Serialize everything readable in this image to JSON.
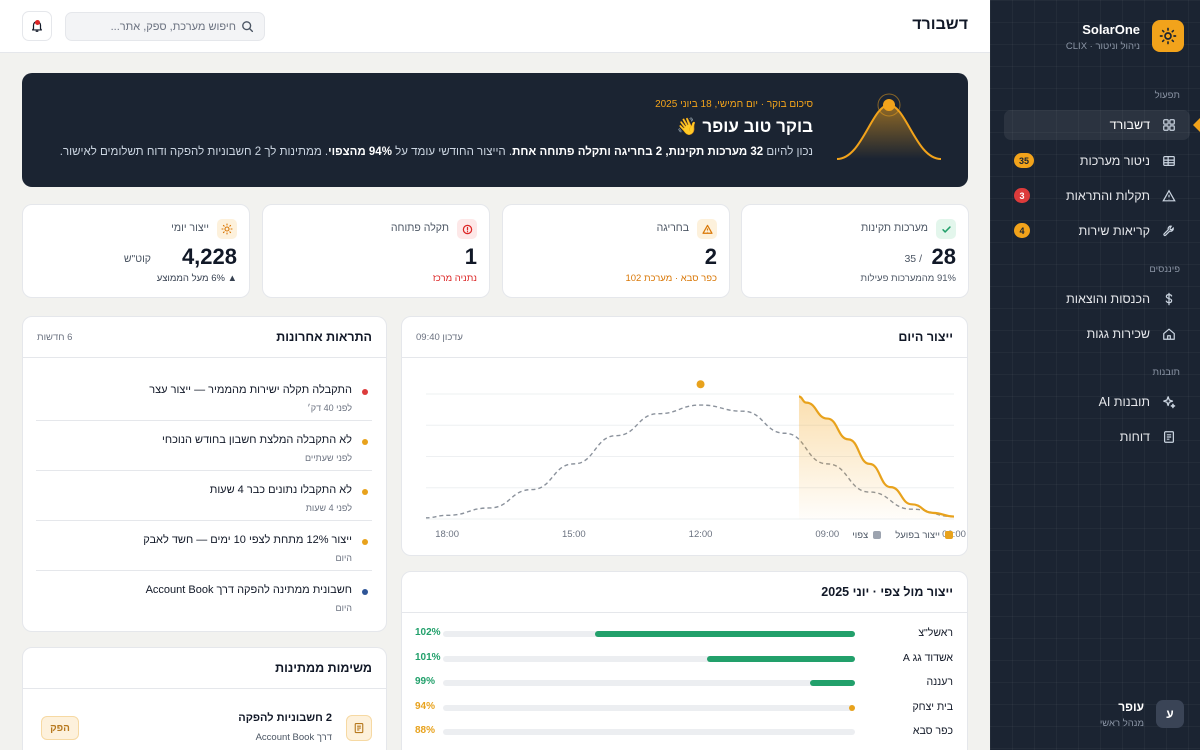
{
  "brand": {
    "name": "SolarOne",
    "subtitle": "ניהול וניטור · CLIX"
  },
  "sidebar": {
    "sections": {
      "operations": "תפעול",
      "finance": "פיננסים",
      "features": "תובנות"
    },
    "items": [
      {
        "label": "דשבורד",
        "icon": "grid-icon",
        "active": true
      },
      {
        "label": "ניטור מערכות",
        "icon": "table-icon",
        "badge": "35",
        "badge_color": "#f2a31b"
      },
      {
        "label": "תקלות והתראות",
        "icon": "warning-icon",
        "badge": "3",
        "badge_color": "#dc3b3b"
      },
      {
        "label": "קריאות שירות",
        "icon": "wrench-icon",
        "badge": "4",
        "badge_color": "#f2a31b"
      },
      {
        "label": "הכנסות והוצאות",
        "icon": "dollar-icon"
      },
      {
        "label": "שכירות גגות",
        "icon": "home-icon"
      },
      {
        "label": "תובנות AI",
        "icon": "sparkle-icon"
      },
      {
        "label": "דוחות",
        "icon": "document-icon"
      }
    ]
  },
  "user": {
    "initial": "ע",
    "name": "עופר",
    "role": "מנהל ראשי"
  },
  "topbar": {
    "title": "דשבורד",
    "search_placeholder": "חיפוש מערכת, ספק, אתר..."
  },
  "banner": {
    "date": "סיכום בוקר · יום חמישי, 18 ביוני 2025",
    "greeting": "בוקר טוב עופר 👋",
    "summary": {
      "t1": "נכון להיום ",
      "b1": "32 מערכות תקינות, 2 בחריגה ו",
      "b2": "תקלה פתוחה אחת",
      "t2": ". הייצור החודשי עומד על ",
      "b3": "94% מהצפוי",
      "t3": ". ממתינות לך 2 חשבוניות להפקה ודוח תשלומים לאישור."
    }
  },
  "kpis": {
    "healthy": {
      "label": "מערכות תקינות",
      "value": "28",
      "suffix": "/ 35",
      "sub": "91% מהמערכות פעילות",
      "sub_color": "#4b5563",
      "icon": "check-icon"
    },
    "deviation": {
      "label": "בחריגה",
      "value": "2",
      "sub": "כפר סבא · מערכת 102",
      "sub_color": "#d97706",
      "icon": "warning-icon"
    },
    "fault": {
      "label": "תקלה פתוחה",
      "value": "1",
      "sub": "נתניה מרכז",
      "sub_color": "#dc2626",
      "icon": "alert-circle-icon"
    },
    "daily": {
      "label": "ייצור יומי",
      "value": "4,228",
      "suffix": "קוט\"ש",
      "sub": "▲ 6% מעל הממוצע",
      "sub_color": "#374151",
      "icon": "sun-icon"
    }
  },
  "production_today": {
    "title": "ייצור היום",
    "meta": "עדכון 09:40",
    "legend": {
      "actual": "ייצור בפועל",
      "expected": "צפוי"
    }
  },
  "chart_data": {
    "type": "line",
    "title": "ייצור היום",
    "x_ticks": [
      "06:00",
      "09:00",
      "12:00",
      "15:00",
      "18:00"
    ],
    "x_range_hours": [
      6,
      18.5
    ],
    "series": [
      {
        "name": "ייצור בפועל",
        "color": "#e8a21c",
        "x": [
          6.0,
          6.5,
          7.0,
          7.5,
          8.0,
          8.5,
          9.0,
          9.5,
          9.67
        ],
        "y": [
          0.02,
          0.05,
          0.12,
          0.26,
          0.45,
          0.65,
          0.82,
          0.95,
          1.0
        ]
      },
      {
        "name": "צפוי",
        "color": "#8b929c",
        "x": [
          6,
          7,
          8,
          9,
          10,
          11,
          12,
          13,
          14,
          15,
          16,
          17,
          18,
          18.5
        ],
        "y": [
          0.02,
          0.08,
          0.22,
          0.45,
          0.7,
          0.88,
          0.93,
          0.86,
          0.68,
          0.45,
          0.24,
          0.09,
          0.03,
          0.01
        ]
      }
    ],
    "marker": {
      "x": 12,
      "y": 1.1
    },
    "ylim": [
      0,
      1.2
    ],
    "grid": true,
    "legend_position": "bottom-right"
  },
  "alerts": {
    "title": "התראות אחרונות",
    "meta": "6 חדשות",
    "items": [
      {
        "title": "התקבלה תקלה ישירות מהממיר — ייצור עצר",
        "time": "לפני 40 דק׳",
        "color": "#dc3b3b"
      },
      {
        "title": "לא התקבלה המלצת חשבון בחודש הנוכחי",
        "time": "לפני שעתיים",
        "color": "#e8a21c"
      },
      {
        "title": "לא התקבלו נתונים כבר 4 שעות",
        "time": "לפני 4 שעות",
        "color": "#e8a21c"
      },
      {
        "title": "ייצור 12% מתחת לצפי 10 ימים — חשד לאבק",
        "time": "היום",
        "color": "#e8a21c"
      },
      {
        "title": "חשבונית ממתינה להפקה דרך Account Book",
        "time": "היום",
        "color": "#2f5597"
      }
    ]
  },
  "vs_expected": {
    "title": "ייצור מול צפי · יוני 2025",
    "rows": [
      {
        "name": "ראשל\"צ",
        "pct_label": "102%",
        "fill": 0.63,
        "color": "#22a06b"
      },
      {
        "name": "אשדוד גג A",
        "pct_label": "101%",
        "fill": 0.36,
        "color": "#22a06b"
      },
      {
        "name": "רעננה",
        "pct_label": "99%",
        "fill": 0.11,
        "color": "#22a06b"
      },
      {
        "name": "בית יצחק",
        "pct_label": "94%",
        "fill": 0.01,
        "color": "#e8a21c"
      },
      {
        "name": "כפר סבא",
        "pct_label": "88%",
        "fill": 0.0,
        "color": "#e8a21c"
      }
    ]
  },
  "tasks": {
    "title": "משימות ממתינות",
    "items": [
      {
        "title": "2 חשבוניות להפקה",
        "sub": "דרך Account Book",
        "action": "הפק"
      }
    ]
  }
}
